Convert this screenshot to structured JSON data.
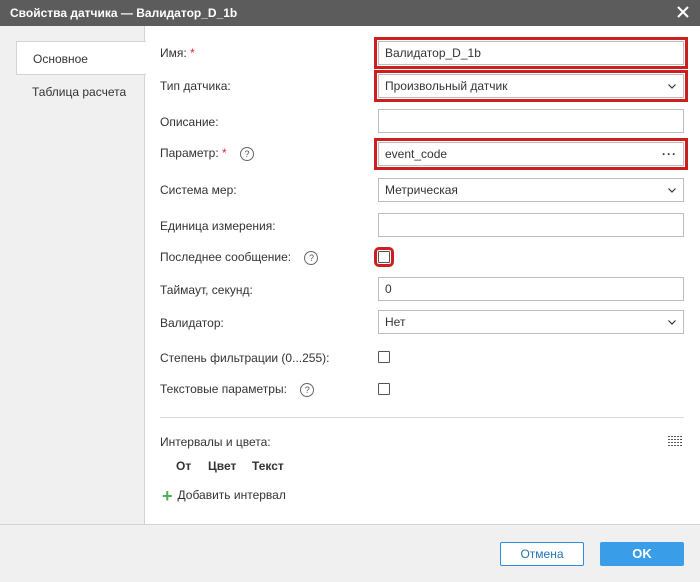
{
  "dialog": {
    "title": "Свойства датчика — Валидатор_D_1b"
  },
  "tabs": [
    {
      "label": "Основное"
    },
    {
      "label": "Таблица расчета"
    }
  ],
  "form": {
    "name_label": "Имя:",
    "name_value": "Валидатор_D_1b",
    "type_label": "Тип датчика:",
    "type_value": "Произвольный датчик",
    "description_label": "Описание:",
    "description_value": "",
    "parameter_label": "Параметр:",
    "parameter_value": "event_code",
    "parameter_button": "···",
    "system_label": "Система мер:",
    "system_value": "Метрическая",
    "unit_label": "Единица измерения:",
    "unit_value": "",
    "last_message_label": "Последнее сообщение:",
    "timeout_label": "Таймаут, секунд:",
    "timeout_value": "0",
    "validator_label": "Валидатор:",
    "validator_value": "Нет",
    "filter_label": "Степень фильтрации (0...255):",
    "text_params_label": "Текстовые параметры:",
    "required_mark": "*",
    "help_mark": "?"
  },
  "intervals": {
    "label": "Интервалы и цвета:",
    "columns": [
      "От",
      "Цвет",
      "Текст"
    ],
    "add_label": "Добавить интервал",
    "add_icon": "+"
  },
  "buttons": {
    "cancel": "Отмена",
    "ok": "OK"
  },
  "colors": {
    "titlebar": "#5c5c5c",
    "highlight": "#cc1f1f",
    "accent": "#3a9de8",
    "plus": "#4caf50"
  }
}
